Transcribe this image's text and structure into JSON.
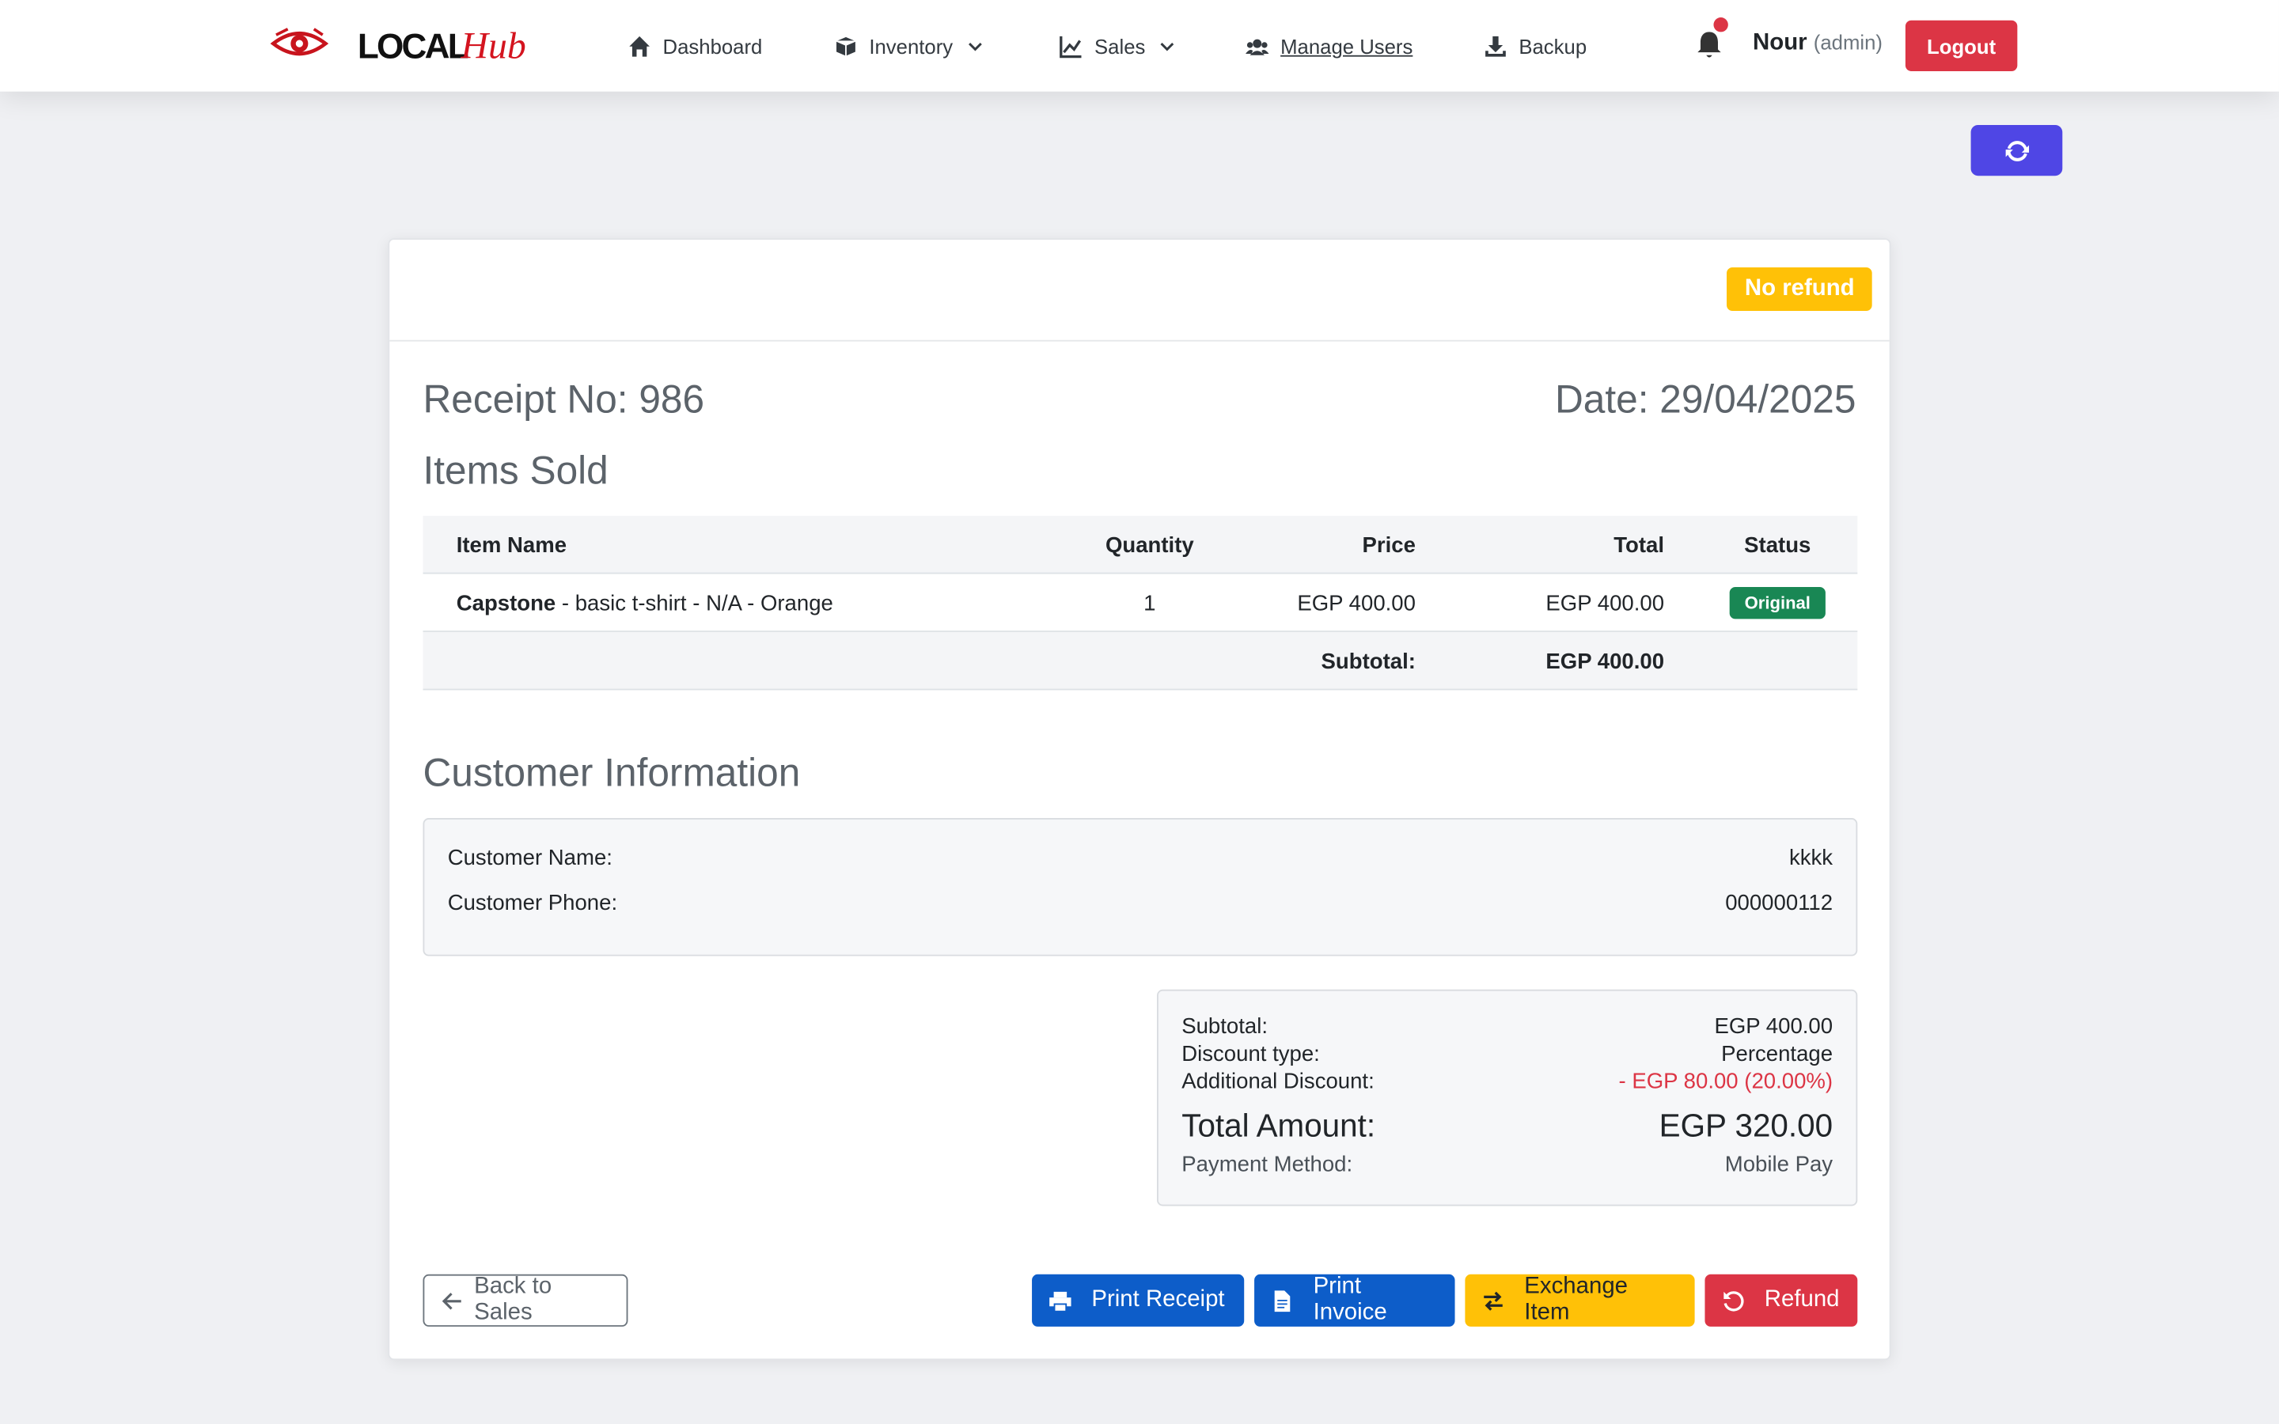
{
  "nav": {
    "brand_local": "LOCAL",
    "brand_hub": "Hub",
    "dashboard": "Dashboard",
    "inventory": "Inventory",
    "sales": "Sales",
    "manage_users": "Manage Users",
    "backup": "Backup",
    "user_name": "Nour",
    "user_role": "(admin)",
    "logout": "Logout"
  },
  "receipt": {
    "refund_badge": "No refund",
    "number": "Receipt No: 986",
    "date": "Date: 29/04/2025",
    "items_title": "Items Sold",
    "columns": {
      "name": "Item Name",
      "qty": "Quantity",
      "price": "Price",
      "total": "Total",
      "status": "Status"
    },
    "items": [
      {
        "brand": "Capstone",
        "desc": " - basic t-shirt - N/A - Orange",
        "qty": "1",
        "price": "EGP 400.00",
        "total": "EGP 400.00",
        "status": "Original"
      }
    ],
    "subtotal_label": "Subtotal:",
    "subtotal_value": "EGP 400.00"
  },
  "customer": {
    "title": "Customer Information",
    "name_label": "Customer Name:",
    "name_value": "kkkk",
    "phone_label": "Customer Phone:",
    "phone_value": "000000112"
  },
  "summary": {
    "subtotal_label": "Subtotal:",
    "subtotal_value": "EGP 400.00",
    "discount_type_label": "Discount type:",
    "discount_type_value": "Percentage",
    "additional_discount_label": "Additional Discount:",
    "additional_discount_value": "- EGP 80.00 (20.00%)",
    "total_label": "Total Amount:",
    "total_value": "EGP 320.00",
    "payment_label": "Payment Method:",
    "payment_value": "Mobile Pay"
  },
  "actions": {
    "back": "Back to Sales",
    "print_receipt": "Print Receipt",
    "print_invoice": "Print Invoice",
    "exchange": "Exchange Item",
    "refund": "Refund"
  },
  "colors": {
    "primary": "#0d5dc9",
    "danger": "#dc3545",
    "warning": "#ffc107",
    "success": "#198754",
    "indigo": "#4f46e5"
  }
}
